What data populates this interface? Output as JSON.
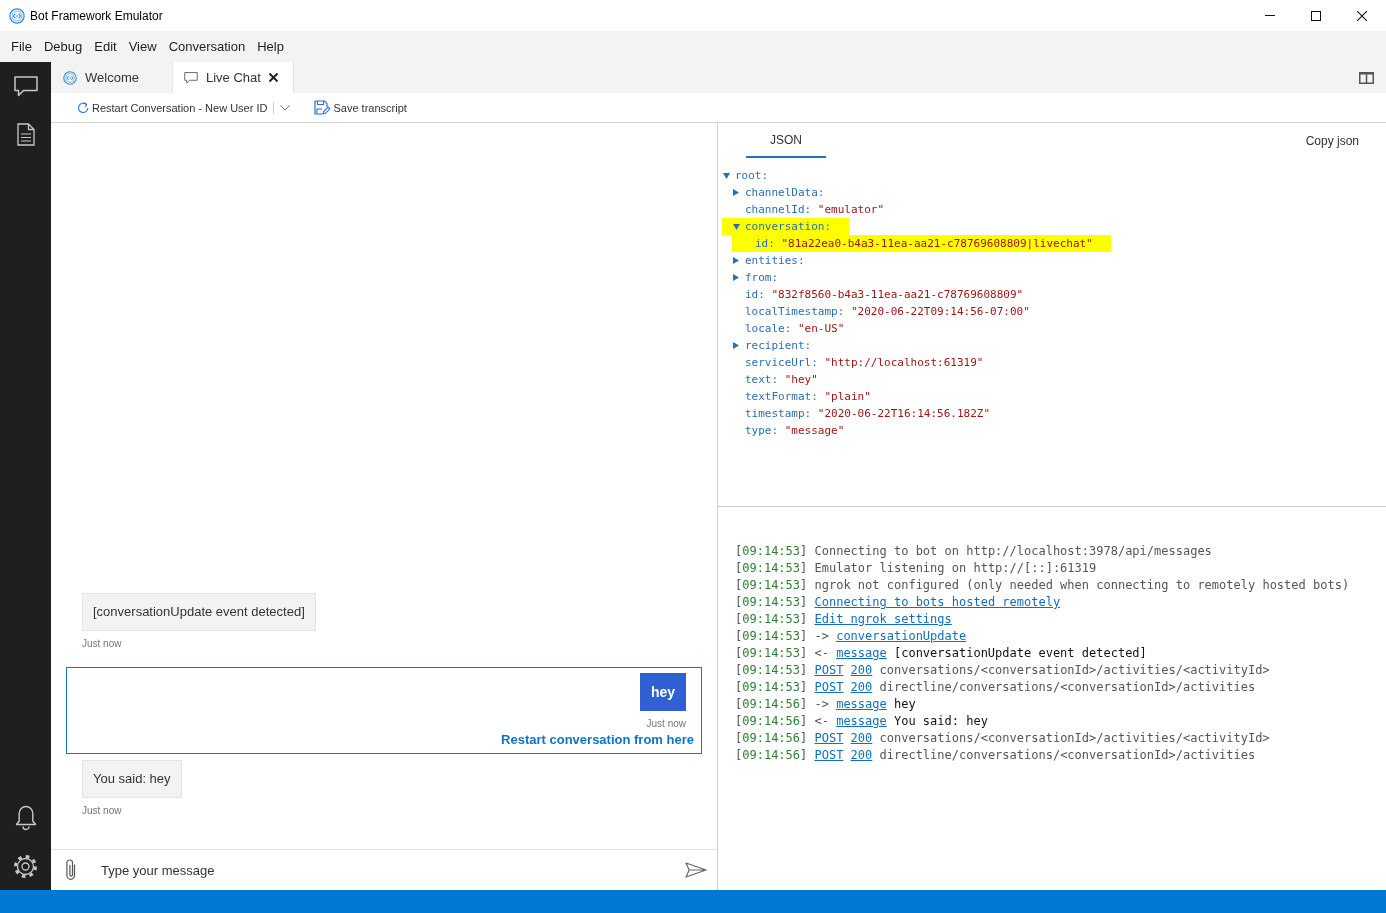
{
  "window": {
    "title": "Bot Framework Emulator"
  },
  "menu": [
    "File",
    "Debug",
    "Edit",
    "View",
    "Conversation",
    "Help"
  ],
  "tabs": [
    {
      "label": "Welcome",
      "kind": "welcome",
      "selected": false,
      "closable": false
    },
    {
      "label": "Live Chat",
      "kind": "chat",
      "selected": true,
      "closable": true
    }
  ],
  "toolbar": [
    {
      "kind": "restart",
      "label": "Restart Conversation - New User ID",
      "dropdown": true
    },
    {
      "kind": "save",
      "label": "Save transcript",
      "dropdown": false
    }
  ],
  "chat": {
    "activities": [
      {
        "kind": "bot",
        "text": "[conversationUpdate event detected]",
        "time": "Just now",
        "selected": false
      },
      {
        "kind": "user",
        "text": "hey",
        "time": "Just now",
        "selected": true,
        "restart_link": "Restart conversation from here"
      },
      {
        "kind": "bot",
        "text": "You said: hey",
        "time": "Just now",
        "selected": false
      }
    ],
    "input": {
      "placeholder": "Type your message"
    }
  },
  "inspector": {
    "tabs": [
      {
        "label": "JSON",
        "selected": true
      }
    ],
    "copy_button": "Copy json",
    "tree": [
      {
        "key": "root:",
        "expanded": true,
        "highlighted": false,
        "children": [
          {
            "key": "channelData:",
            "expanded": false,
            "highlighted": false
          },
          {
            "key": "channelId:",
            "value": "\"emulator\"",
            "highlighted": false
          },
          {
            "key": "conversation:",
            "expanded": true,
            "highlighted": true,
            "children": [
              {
                "key": "id:",
                "value": "\"81a22ea0-b4a3-11ea-aa21-c78769608809|livechat\"",
                "highlighted": true
              }
            ]
          },
          {
            "key": "entities:",
            "expanded": false,
            "highlighted": false
          },
          {
            "key": "from:",
            "expanded": false,
            "highlighted": false
          },
          {
            "key": "id:",
            "value": "\"832f8560-b4a3-11ea-aa21-c78769608809\"",
            "highlighted": false
          },
          {
            "key": "localTimestamp:",
            "value": "\"2020-06-22T09:14:56-07:00\"",
            "highlighted": false
          },
          {
            "key": "locale:",
            "value": "\"en-US\"",
            "highlighted": false
          },
          {
            "key": "recipient:",
            "expanded": false,
            "highlighted": false
          },
          {
            "key": "serviceUrl:",
            "value": "\"http://localhost:61319\"",
            "highlighted": false
          },
          {
            "key": "text:",
            "value": "\"hey\"",
            "highlighted": false
          },
          {
            "key": "textFormat:",
            "value": "\"plain\"",
            "highlighted": false
          },
          {
            "key": "timestamp:",
            "value": "\"2020-06-22T16:14:56.182Z\"",
            "highlighted": false
          },
          {
            "key": "type:",
            "value": "\"message\"",
            "highlighted": false
          }
        ]
      }
    ]
  },
  "log": [
    {
      "time": "[09:14:53]",
      "parts": [
        {
          "kind": "text",
          "text": "Connecting to bot on http://localhost:3978/api/messages"
        }
      ]
    },
    {
      "time": "[09:14:53]",
      "parts": [
        {
          "kind": "text",
          "text": "Emulator listening on http://[::]:61319"
        }
      ]
    },
    {
      "time": "[09:14:53]",
      "parts": [
        {
          "kind": "text",
          "text": "ngrok not configured (only needed when connecting to remotely hosted bots)"
        }
      ]
    },
    {
      "time": "[09:14:53]",
      "parts": [
        {
          "kind": "link",
          "text": "Connecting to bots hosted remotely"
        }
      ]
    },
    {
      "time": "[09:14:53]",
      "parts": [
        {
          "kind": "link",
          "text": "Edit ngrok settings"
        }
      ]
    },
    {
      "time": "[09:14:53]",
      "parts": [
        {
          "kind": "text",
          "text": "->"
        },
        {
          "kind": "link",
          "text": "conversationUpdate"
        }
      ]
    },
    {
      "time": "[09:14:53]",
      "parts": [
        {
          "kind": "text",
          "text": "<-"
        },
        {
          "kind": "link",
          "text": "message"
        },
        {
          "kind": "content",
          "text": "[conversationUpdate event detected]"
        }
      ]
    },
    {
      "time": "[09:14:53]",
      "parts": [
        {
          "kind": "link",
          "text": "POST"
        },
        {
          "kind": "link",
          "text": "200"
        },
        {
          "kind": "text",
          "text": "conversations/<conversationId>/activities/<activityId>"
        }
      ]
    },
    {
      "time": "[09:14:53]",
      "parts": [
        {
          "kind": "link",
          "text": "POST"
        },
        {
          "kind": "link",
          "text": "200"
        },
        {
          "kind": "text",
          "text": "directline/conversations/<conversationId>/activities"
        }
      ]
    },
    {
      "time": "[09:14:56]",
      "parts": [
        {
          "kind": "text",
          "text": "->"
        },
        {
          "kind": "link",
          "text": "message"
        },
        {
          "kind": "content",
          "text": "hey"
        }
      ]
    },
    {
      "time": "[09:14:56]",
      "parts": [
        {
          "kind": "text",
          "text": "<-"
        },
        {
          "kind": "link",
          "text": "message"
        },
        {
          "kind": "content",
          "text": "You said: hey"
        }
      ]
    },
    {
      "time": "[09:14:56]",
      "parts": [
        {
          "kind": "link",
          "text": "POST"
        },
        {
          "kind": "link",
          "text": "200"
        },
        {
          "kind": "text",
          "text": "conversations/<conversationId>/activities/<activityId>"
        }
      ]
    },
    {
      "time": "[09:14:56]",
      "parts": [
        {
          "kind": "link",
          "text": "POST"
        },
        {
          "kind": "link",
          "text": "200"
        },
        {
          "kind": "text",
          "text": "directline/conversations/<conversationId>/activities"
        }
      ]
    }
  ]
}
